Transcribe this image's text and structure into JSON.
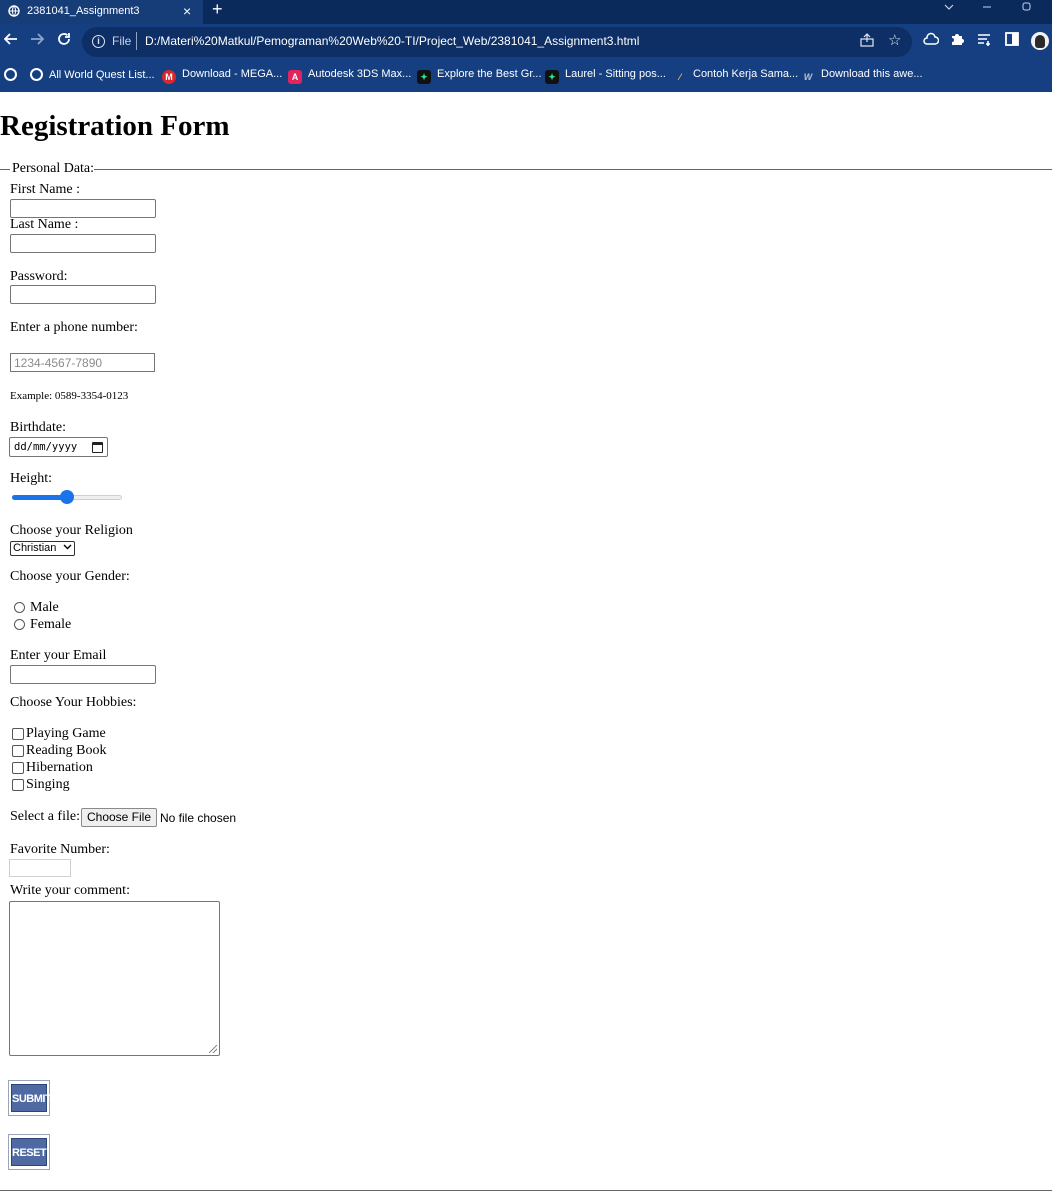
{
  "browser": {
    "tab_title": "2381041_Assignment3",
    "tab_close": "×",
    "new_tab": "+",
    "url_scheme": "File",
    "url": "D:/Materi%20Matkul/Pemograman%20Web%20-TI/Project_Web/2381041_Assignment3.html",
    "bookmarks": [
      {
        "label": "All World Quest List...",
        "icon": "globe-icon"
      },
      {
        "label": "Download - MEGA...",
        "icon": "mega-icon"
      },
      {
        "label": "Autodesk 3DS Max...",
        "icon": "autodesk-icon"
      },
      {
        "label": "Explore the Best Gr...",
        "icon": "envato-icon"
      },
      {
        "label": "Laurel - Sitting pos...",
        "icon": "envato-icon"
      },
      {
        "label": "Contoh Kerja Sama...",
        "icon": "dash-icon"
      },
      {
        "label": "Download this awe...",
        "icon": "w-icon"
      }
    ]
  },
  "page": {
    "title": "Registration Form",
    "legend": "Personal Data:",
    "first_name_label": "First Name :",
    "last_name_label": "Last Name :",
    "password_label": "Password:",
    "phone_label": "Enter a phone number:",
    "phone_placeholder": "1234-4567-7890",
    "phone_example": "Example: 0589-3354-0123",
    "birthdate_label": "Birthdate:",
    "birthdate_value": "dd/mm/yyyy",
    "height_label": "Height:",
    "height_slider_level": 0.5,
    "religion_label": "Choose your Religion",
    "religion_selected": "Christian",
    "gender_label": "Choose your Gender:",
    "gender_options": [
      "Male",
      "Female"
    ],
    "email_label": "Enter your Email",
    "hobbies_label": "Choose Your Hobbies:",
    "hobbies": [
      "Playing Game",
      "Reading Book",
      "Hibernation",
      "Singing"
    ],
    "file_label": "Select a file:",
    "file_button": "Choose File",
    "file_status": "No file chosen",
    "favorite_label": "Favorite Number:",
    "comment_label": "Write your comment:",
    "submit_label": "SUBMIT",
    "reset_label": "RESET"
  },
  "colors": {
    "chrome_dark": "#0a2a5c",
    "chrome": "#153f80",
    "slider_accent": "#1a73e8",
    "image_button": "#4f6aa3"
  }
}
